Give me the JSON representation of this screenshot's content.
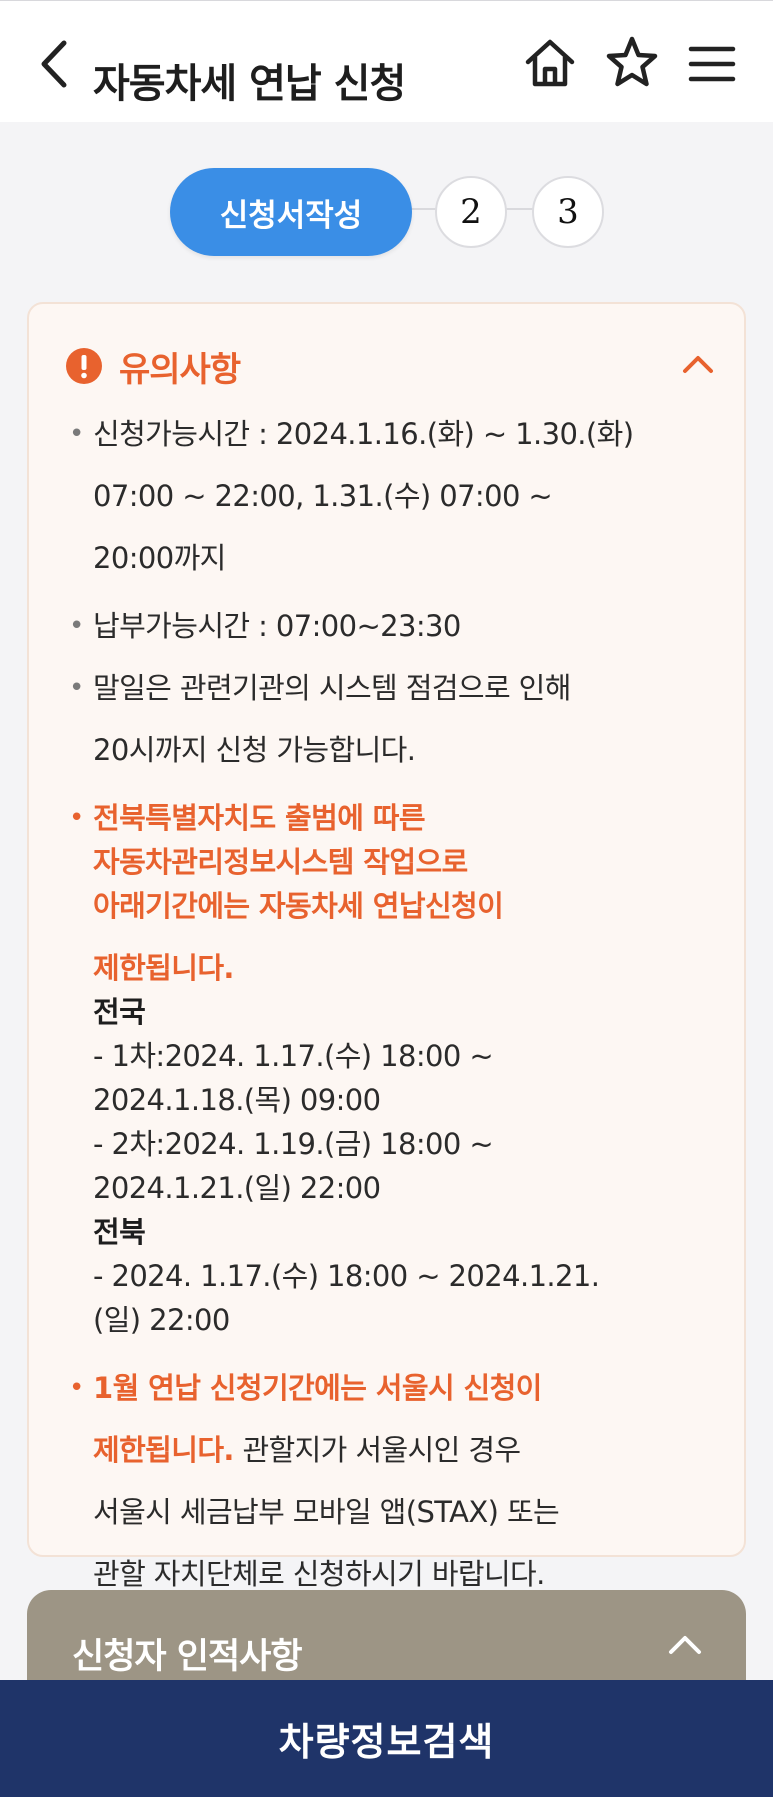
{
  "header": {
    "title": "자동차세 연납 신청",
    "icons": {
      "back": "chevron-left-icon",
      "home": "home-icon",
      "favorite": "star-icon",
      "menu": "hamburger-menu-icon"
    }
  },
  "steps": {
    "active_label": "신청서작성",
    "step2": "2",
    "step3": "3"
  },
  "notice": {
    "title": "유의사항",
    "accent_color": "#e8622e",
    "items": [
      {
        "lines": [
          "신청가능시간 : 2024.1.16.(화) ~ 1.30.(화)",
          "07:00 ~ 22:00, 1.31.(수) 07:00 ~",
          "20:00까지"
        ]
      },
      {
        "lines": [
          "납부가능시간 : 07:00~23:30"
        ]
      },
      {
        "lines": [
          "말일은 관련기관의 시스템 점검으로 인해",
          "20시까지 신청 가능합니다."
        ]
      },
      {
        "highlight_lines": [
          "전북특별자치도 출범에 따른",
          "자동차관리정보시스템 작업으로",
          "아래기간에는 자동차세 연납신청이",
          "제한됩니다."
        ],
        "national_head": "전국",
        "national_lines": [
          "- 1차:2024. 1.17.(수) 18:00 ~",
          "2024.1.18.(목) 09:00",
          "- 2차:2024. 1.19.(금) 18:00 ~",
          "2024.1.21.(일) 22:00"
        ],
        "jeonbuk_head": "전북",
        "jeonbuk_lines": [
          "- 2024. 1.17.(수) 18:00 ~ 2024.1.21.",
          "(일) 22:00"
        ]
      },
      {
        "highlight_lines": [
          "1월 연납 신청기간에는 서울시 신청이",
          "제한됩니다."
        ],
        "rest_inline": " 관할지가 서울시인 경우",
        "rest_lines": [
          "서울시 세금납부 모바일 앱(STAX) 또는",
          "관할 자치단체로 신청하시기 바랍니다."
        ]
      }
    ]
  },
  "applicant": {
    "title": "신청자 인적사항"
  },
  "bottom_button": {
    "label": "차량정보검색"
  },
  "colors": {
    "primary_blue": "#3a8ee6",
    "navy": "#1f3469",
    "section_brown": "#9d9585"
  }
}
